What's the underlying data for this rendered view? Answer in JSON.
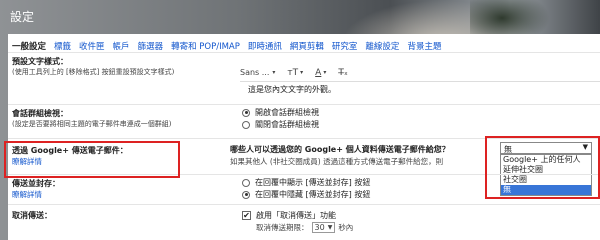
{
  "page": {
    "title": "設定"
  },
  "tabs": [
    "一般設定",
    "標籤",
    "收件匣",
    "帳戶",
    "篩選器",
    "轉寄和 POP/IMAP",
    "即時通訊",
    "網頁剪輯",
    "研究室",
    "離線設定",
    "背景主題"
  ],
  "default_style": {
    "label": "預設文字樣式：",
    "sub": "(使用工具列上的 [移除格式] 按鈕重設預設文字樣式)",
    "font": "Sans ...",
    "font_size_icon": "text-size-icon",
    "text_color_icon": "text-color-icon",
    "clear_format_icon": "clear-format-icon",
    "sample": "這是您內文文字的外觀。"
  },
  "conversation": {
    "label": "會話群組檢視：",
    "sub": "(設定是否要將相同主題的電子郵件串連成一個群組)",
    "opt_on": "開啟會話群組檢視",
    "opt_off": "關閉會話群組檢視"
  },
  "gplus": {
    "label": "透過 Google+ 傳送電子郵件：",
    "learn_more": "瞭解詳情",
    "question": "哪些人可以透過您的 Google+ 個人資料傳送電子郵件給您？",
    "sub": "如果其他人 (非社交圈成員) 透過這種方式傳送電子郵件給您，則",
    "selected": "無",
    "options": [
      "Google+ 上的任何人",
      "延伸社交圈",
      "社交圈",
      "無"
    ],
    "highlight_color": "#dd2222"
  },
  "send_archive": {
    "label": "傳送並封存：",
    "learn_more": "瞭解詳情",
    "opt_show": "在回覆中顯示 [傳送並封存] 按鈕",
    "opt_hide": "在回覆中隱藏 [傳送並封存] 按鈕"
  },
  "undo_send": {
    "label": "取消傳送：",
    "checkbox": "啟用「取消傳送」功能",
    "period_label": "取消傳送期限：",
    "period_value": "30",
    "unit": "秒內"
  }
}
